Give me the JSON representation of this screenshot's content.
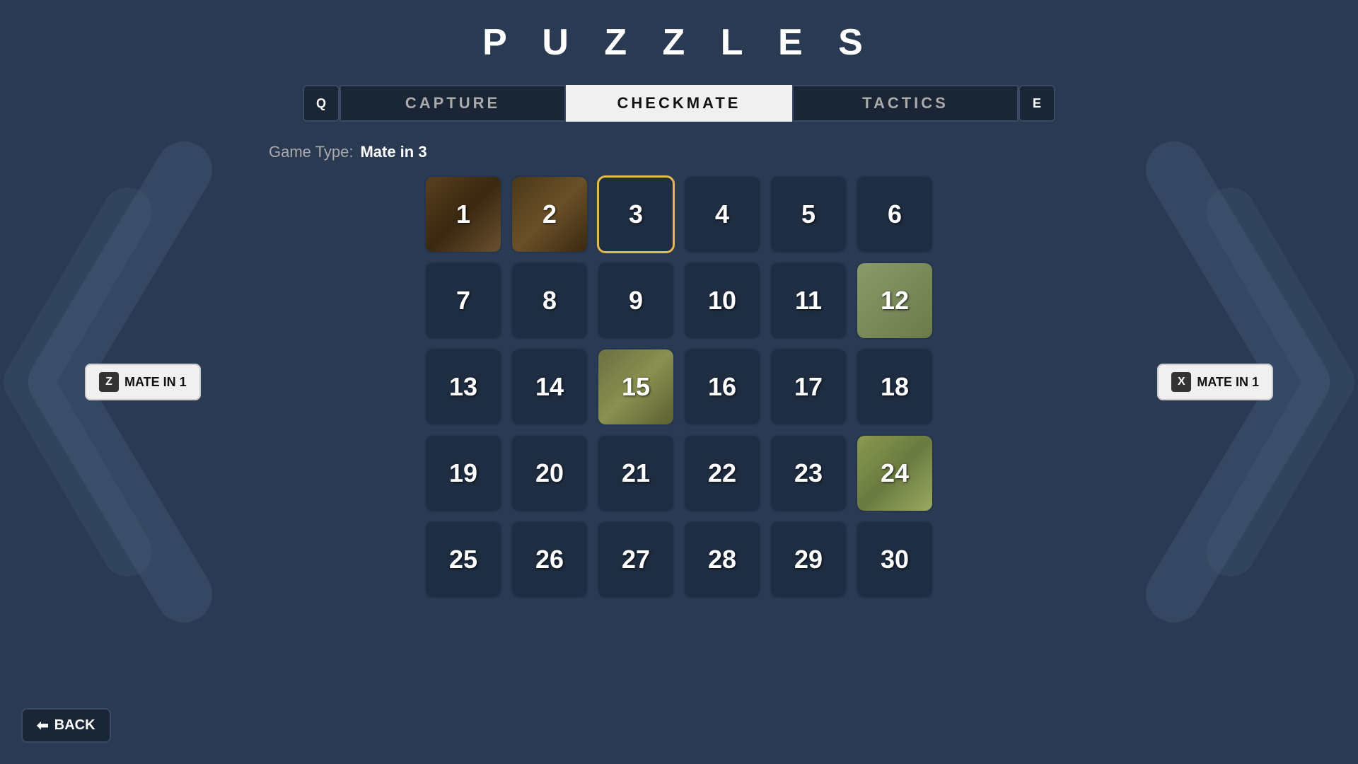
{
  "page": {
    "title": "P U Z Z L E S",
    "background_color": "#2a3a52"
  },
  "tabs": [
    {
      "id": "capture",
      "label": "CAPTURE",
      "active": false
    },
    {
      "id": "checkmate",
      "label": "CHECKMATE",
      "active": true
    },
    {
      "id": "tactics",
      "label": "TACTICS",
      "active": false
    }
  ],
  "tab_icons": {
    "left": "Q",
    "right": "E"
  },
  "game_type": {
    "label": "Game Type:",
    "value": "Mate in 3"
  },
  "puzzles": [
    {
      "id": 1,
      "number": "1",
      "selected": false,
      "has_image": true,
      "image_class": "cell-img-1"
    },
    {
      "id": 2,
      "number": "2",
      "selected": false,
      "has_image": true,
      "image_class": "cell-img-2"
    },
    {
      "id": 3,
      "number": "3",
      "selected": true,
      "has_image": false,
      "image_class": ""
    },
    {
      "id": 4,
      "number": "4",
      "selected": false,
      "has_image": false,
      "image_class": ""
    },
    {
      "id": 5,
      "number": "5",
      "selected": false,
      "has_image": false,
      "image_class": ""
    },
    {
      "id": 6,
      "number": "6",
      "selected": false,
      "has_image": false,
      "image_class": ""
    },
    {
      "id": 7,
      "number": "7",
      "selected": false,
      "has_image": false,
      "image_class": ""
    },
    {
      "id": 8,
      "number": "8",
      "selected": false,
      "has_image": false,
      "image_class": ""
    },
    {
      "id": 9,
      "number": "9",
      "selected": false,
      "has_image": false,
      "image_class": ""
    },
    {
      "id": 10,
      "number": "10",
      "selected": false,
      "has_image": false,
      "image_class": ""
    },
    {
      "id": 11,
      "number": "11",
      "selected": false,
      "has_image": false,
      "image_class": ""
    },
    {
      "id": 12,
      "number": "12",
      "selected": false,
      "has_image": true,
      "image_class": "cell-img-12"
    },
    {
      "id": 13,
      "number": "13",
      "selected": false,
      "has_image": false,
      "image_class": ""
    },
    {
      "id": 14,
      "number": "14",
      "selected": false,
      "has_image": false,
      "image_class": ""
    },
    {
      "id": 15,
      "number": "15",
      "selected": false,
      "has_image": true,
      "image_class": "cell-img-15"
    },
    {
      "id": 16,
      "number": "16",
      "selected": false,
      "has_image": false,
      "image_class": ""
    },
    {
      "id": 17,
      "number": "17",
      "selected": false,
      "has_image": false,
      "image_class": ""
    },
    {
      "id": 18,
      "number": "18",
      "selected": false,
      "has_image": false,
      "image_class": ""
    },
    {
      "id": 19,
      "number": "19",
      "selected": false,
      "has_image": false,
      "image_class": ""
    },
    {
      "id": 20,
      "number": "20",
      "selected": false,
      "has_image": false,
      "image_class": ""
    },
    {
      "id": 21,
      "number": "21",
      "selected": false,
      "has_image": false,
      "image_class": ""
    },
    {
      "id": 22,
      "number": "22",
      "selected": false,
      "has_image": false,
      "image_class": ""
    },
    {
      "id": 23,
      "number": "23",
      "selected": false,
      "has_image": false,
      "image_class": ""
    },
    {
      "id": 24,
      "number": "24",
      "selected": false,
      "has_image": true,
      "image_class": "cell-img-24"
    },
    {
      "id": 25,
      "number": "25",
      "selected": false,
      "has_image": false,
      "image_class": ""
    },
    {
      "id": 26,
      "number": "26",
      "selected": false,
      "has_image": false,
      "image_class": ""
    },
    {
      "id": 27,
      "number": "27",
      "selected": false,
      "has_image": false,
      "image_class": ""
    },
    {
      "id": 28,
      "number": "28",
      "selected": false,
      "has_image": false,
      "image_class": ""
    },
    {
      "id": 29,
      "number": "29",
      "selected": false,
      "has_image": false,
      "image_class": ""
    },
    {
      "id": 30,
      "number": "30",
      "selected": false,
      "has_image": false,
      "image_class": ""
    }
  ],
  "side_buttons": {
    "left": {
      "key": "Z",
      "label": "MATE IN 1"
    },
    "right": {
      "key": "X",
      "label": "MATE IN 1"
    }
  },
  "back_button": {
    "label": "BACK",
    "icon": "←"
  }
}
